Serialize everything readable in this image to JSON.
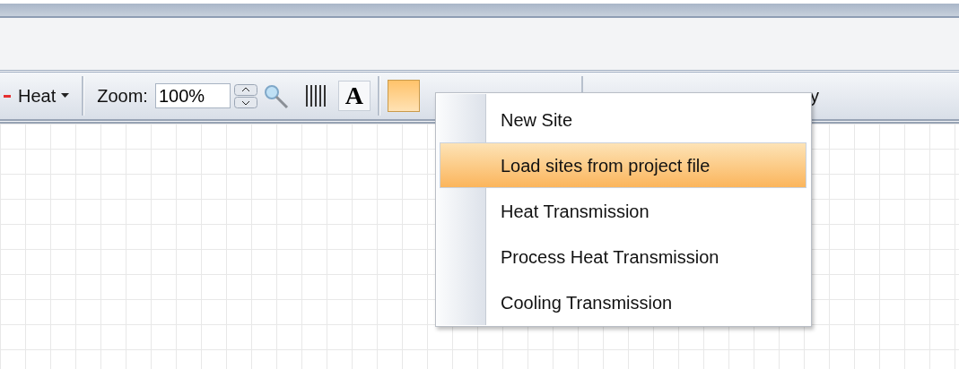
{
  "toolbar": {
    "heat_dropdown": {
      "label": "Heat"
    },
    "zoom": {
      "label": "Zoom:",
      "value": "100%"
    },
    "font_button": {
      "label": "A"
    },
    "label_fragment": "y"
  },
  "context_menu": {
    "items": [
      {
        "label": "New Site",
        "selected": false
      },
      {
        "label": "Load sites from project file",
        "selected": true
      },
      {
        "label": "Heat Transmission",
        "selected": false
      },
      {
        "label": "Process Heat Transmission",
        "selected": false
      },
      {
        "label": "Cooling Transmission",
        "selected": false
      }
    ]
  }
}
